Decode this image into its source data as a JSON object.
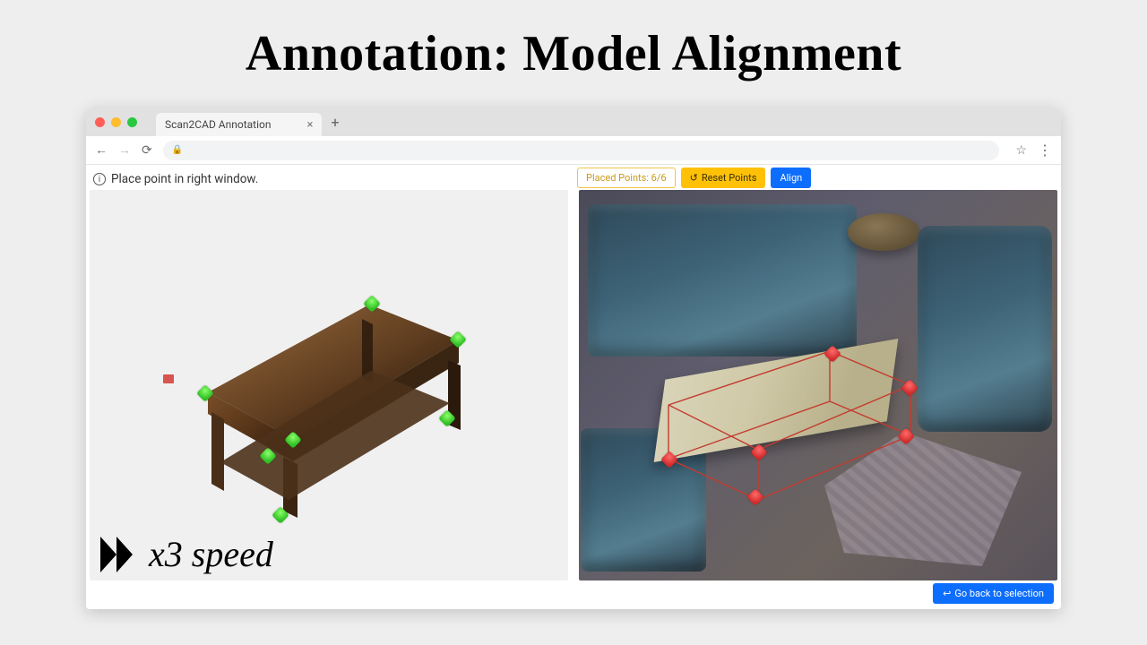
{
  "slide": {
    "title": "Annotation: Model Alignment"
  },
  "browser": {
    "tab_title": "Scan2CAD Annotation"
  },
  "app": {
    "status_message": "Place point in right window.",
    "placed_points_label": "Placed Points: 6/6",
    "reset_points_label": "Reset Points",
    "align_label": "Align",
    "go_back_label": "Go back to selection"
  },
  "overlay": {
    "speed_label": "x3 speed"
  }
}
